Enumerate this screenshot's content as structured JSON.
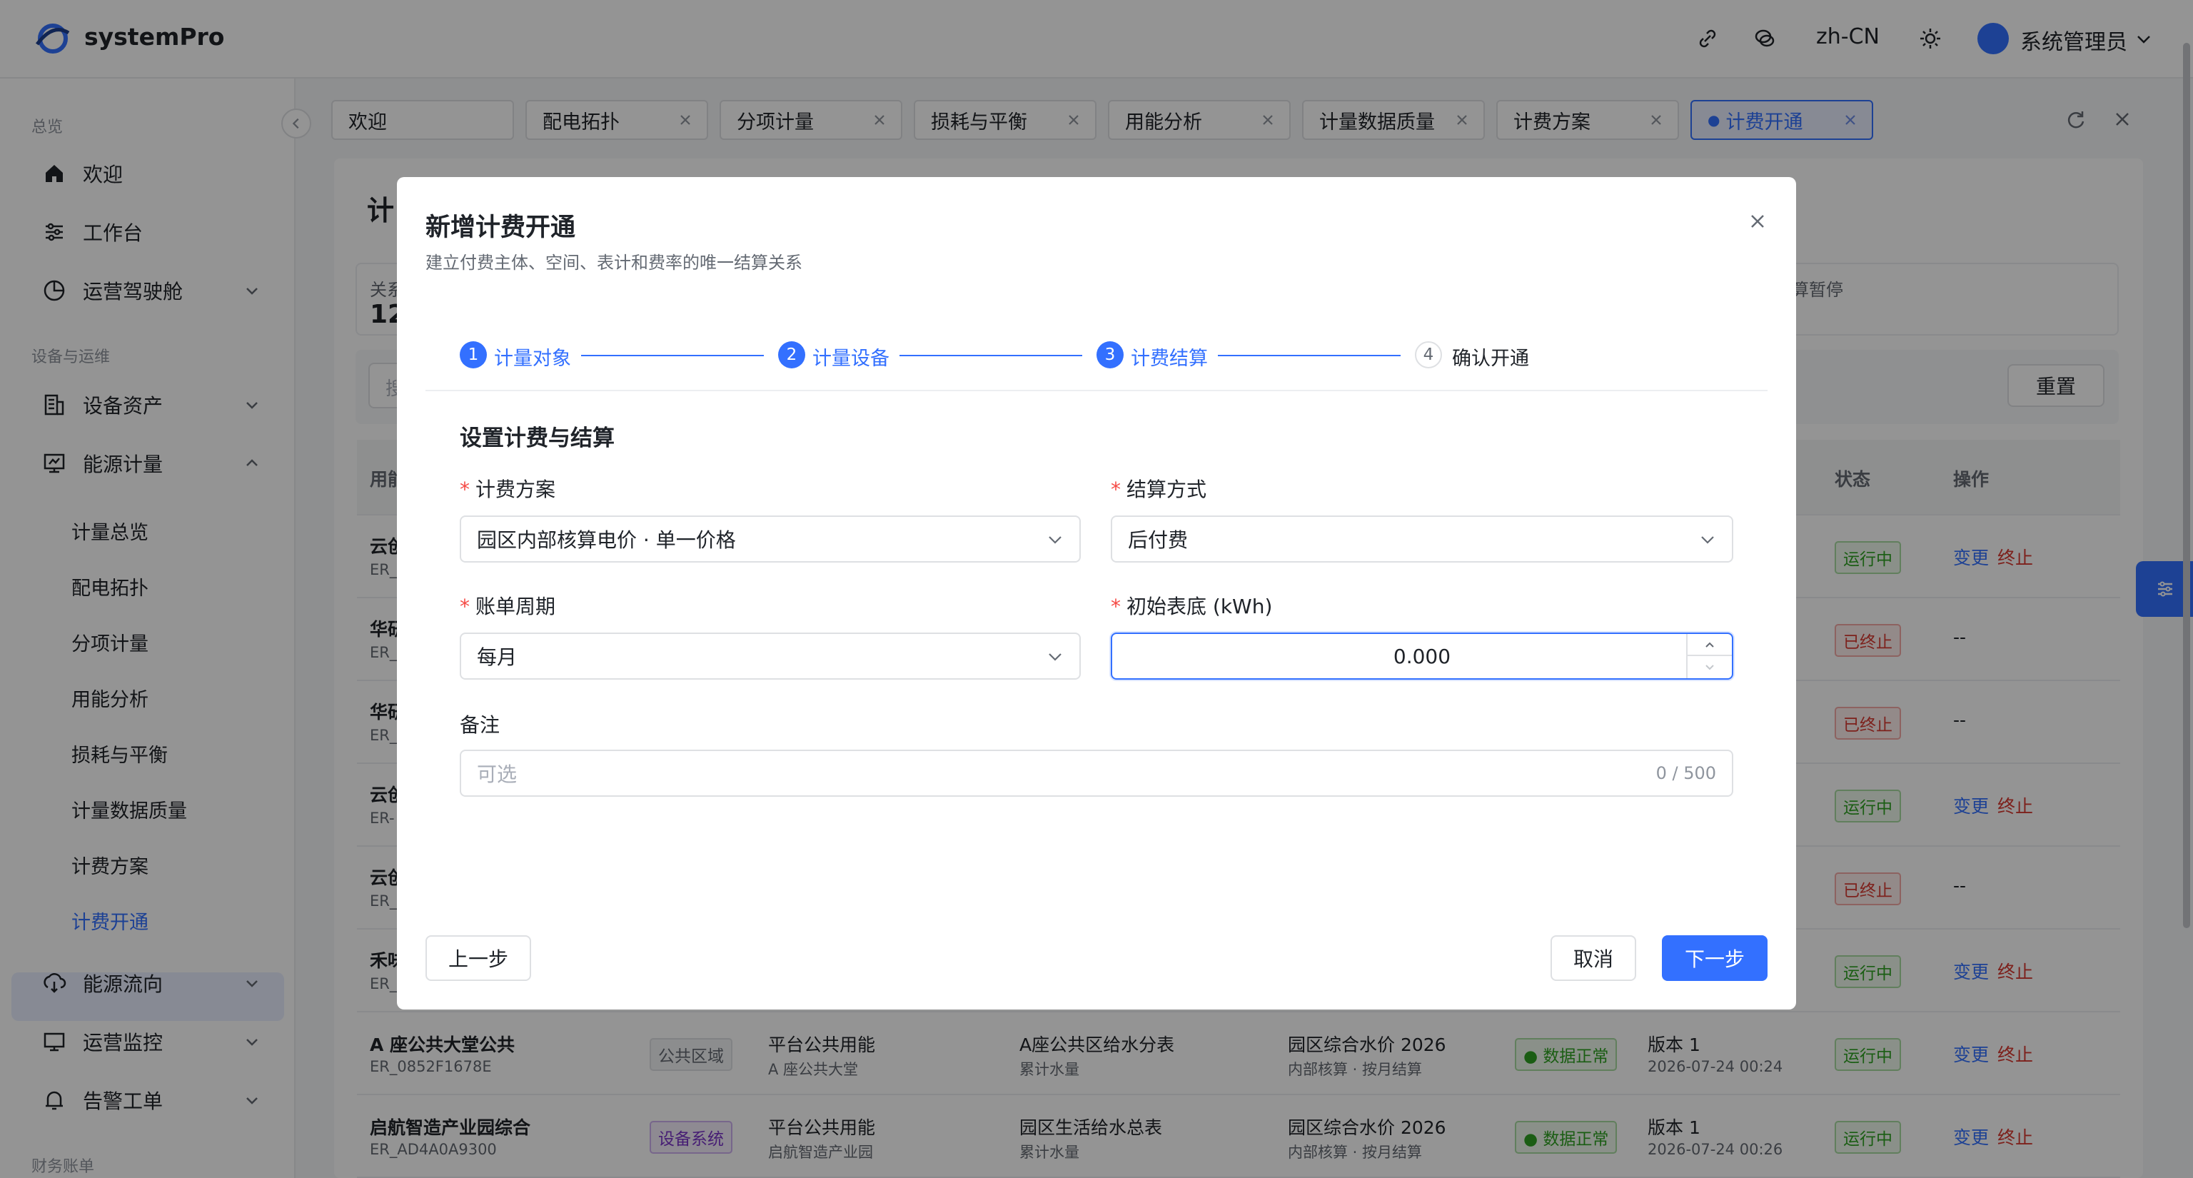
{
  "app": {
    "brand": "systemPro",
    "lang": "zh-CN",
    "user": "系统管理员",
    "accent": "#3370ff"
  },
  "sidebar": {
    "sections": {
      "overview": "总览",
      "ops": "设备与运维",
      "finance": "财务账单"
    },
    "items": [
      {
        "label": "欢迎",
        "icon": "home-icon"
      },
      {
        "label": "工作台",
        "icon": "sliders-icon"
      },
      {
        "label": "运营驾驶舱",
        "icon": "pie-chart-icon"
      },
      {
        "label": "设备资产",
        "icon": "building-icon"
      },
      {
        "label": "能源计量",
        "icon": "meter-icon"
      },
      {
        "label": "能源流向",
        "icon": "flow-icon"
      },
      {
        "label": "运营监控",
        "icon": "monitor-icon"
      },
      {
        "label": "告警工单",
        "icon": "bell-icon"
      }
    ],
    "subitems": [
      "计量总览",
      "配电拓扑",
      "分项计量",
      "用能分析",
      "损耗与平衡",
      "计量数据质量",
      "计费方案",
      "计费开通"
    ],
    "active": "计费开通"
  },
  "tabs": [
    "欢迎",
    "配电拓扑",
    "分项计量",
    "损耗与平衡",
    "用能分析",
    "计量数据质量",
    "计费方案",
    "计费开通"
  ],
  "page": {
    "title_partial": "计",
    "stat_label": "关系",
    "stat_value": "12",
    "stat_right": "算暂停",
    "search_ph": "搜",
    "reset": "重置",
    "cols": {
      "c1": "用能",
      "status": "状态",
      "ops": "操作"
    }
  },
  "table": {
    "rows": [
      {
        "name": "云创",
        "code": "ER_",
        "status": "运行中",
        "ops": [
          "变更",
          "终止"
        ]
      },
      {
        "name": "华研",
        "code": "ER_",
        "status": "已终止",
        "ops": [
          "--"
        ]
      },
      {
        "name": "华研",
        "code": "ER_",
        "status": "已终止",
        "ops": [
          "--"
        ]
      },
      {
        "name": "云创",
        "code": "ER-",
        "status": "运行中",
        "ops": [
          "变更",
          "终止"
        ]
      },
      {
        "name": "云创",
        "code": "ER_",
        "status": "已终止",
        "ops": [
          "--"
        ]
      },
      {
        "name": "禾味",
        "code": "ER_",
        "status": "运行中",
        "ops": [
          "变更",
          "终止"
        ]
      },
      {
        "name": "A 座公共大堂公共",
        "code": "ER_0852F1678E",
        "type": "公共区域",
        "party": "平台公共用能",
        "party_sub": "A 座公共大堂",
        "meter": "A座公共区给水分表",
        "meter_sub": "累计水量",
        "plan": "园区综合水价 2026",
        "plan_sub": "内部核算 · 按月结算",
        "quality": "数据正常",
        "ver": "版本 1",
        "time": "2026-07-24 00:24",
        "status": "运行中",
        "ops": [
          "变更",
          "终止"
        ]
      },
      {
        "name": "启航智造产业园综合",
        "code": "ER_AD4A0A9300",
        "type": "设备系统",
        "party": "平台公共用能",
        "party_sub": "启航智造产业园",
        "meter": "园区生活给水总表",
        "meter_sub": "累计水量",
        "plan": "园区综合水价 2026",
        "plan_sub": "内部核算 · 按月结算",
        "quality": "数据正常",
        "ver": "版本 1",
        "time": "2026-07-24 00:26",
        "status": "运行中",
        "ops": [
          "变更",
          "终止"
        ]
      }
    ]
  },
  "modal": {
    "title": "新增计费开通",
    "subtitle": "建立付费主体、空间、表计和费率的唯一结算关系",
    "steps": [
      {
        "num": "1",
        "label": "计量对象"
      },
      {
        "num": "2",
        "label": "计量设备"
      },
      {
        "num": "3",
        "label": "计费结算"
      },
      {
        "num": "4",
        "label": "确认开通"
      }
    ],
    "section": "设置计费与结算",
    "fields": {
      "plan": {
        "label": "计费方案",
        "value": "园区内部核算电价 · 单一价格"
      },
      "settle": {
        "label": "结算方式",
        "value": "后付费"
      },
      "cycle": {
        "label": "账单周期",
        "value": "每月"
      },
      "reading": {
        "label": "初始表底 (kWh)",
        "value": "0.000"
      },
      "note": {
        "label": "备注",
        "placeholder": "可选",
        "count": "0 / 500"
      }
    },
    "buttons": {
      "prev": "上一步",
      "cancel": "取消",
      "next": "下一步"
    }
  }
}
